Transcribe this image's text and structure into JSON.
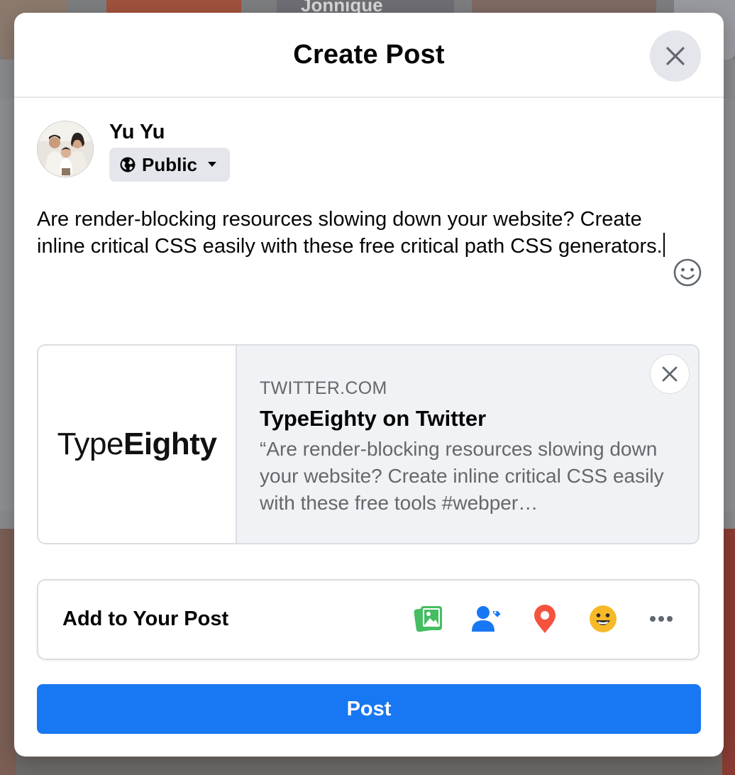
{
  "background": {
    "story_label": "Jonnique"
  },
  "modal": {
    "title": "Create Post",
    "close_icon": "close-icon"
  },
  "user": {
    "name": "Yu Yu",
    "audience": "Public",
    "audience_icon": "globe-icon"
  },
  "composer": {
    "text": "Are render-blocking resources slowing down your website? Create inline critical CSS easily with these free critical path CSS generators.",
    "emoji_icon": "smiley-icon"
  },
  "link_preview": {
    "logo_light": "Type",
    "logo_bold": "Eighty",
    "domain": "TWITTER.COM",
    "title": "TypeEighty on Twitter",
    "description": "“Are render-blocking resources slowing down your website? Create inline critical CSS easily with these free tools #webper…"
  },
  "add_to_post": {
    "label": "Add to Your Post",
    "icons": [
      "photo-video-icon",
      "tag-people-icon",
      "check-in-icon",
      "feeling-icon",
      "more-icon"
    ]
  },
  "post_button": {
    "label": "Post"
  },
  "colors": {
    "accent": "#1877f2",
    "photo": "#45bd62",
    "tag": "#1877f2",
    "checkin": "#f5533d",
    "feeling": "#f7b928",
    "more": "#606770",
    "secondary_text": "#65676b",
    "button_gray": "#e4e6eb"
  }
}
